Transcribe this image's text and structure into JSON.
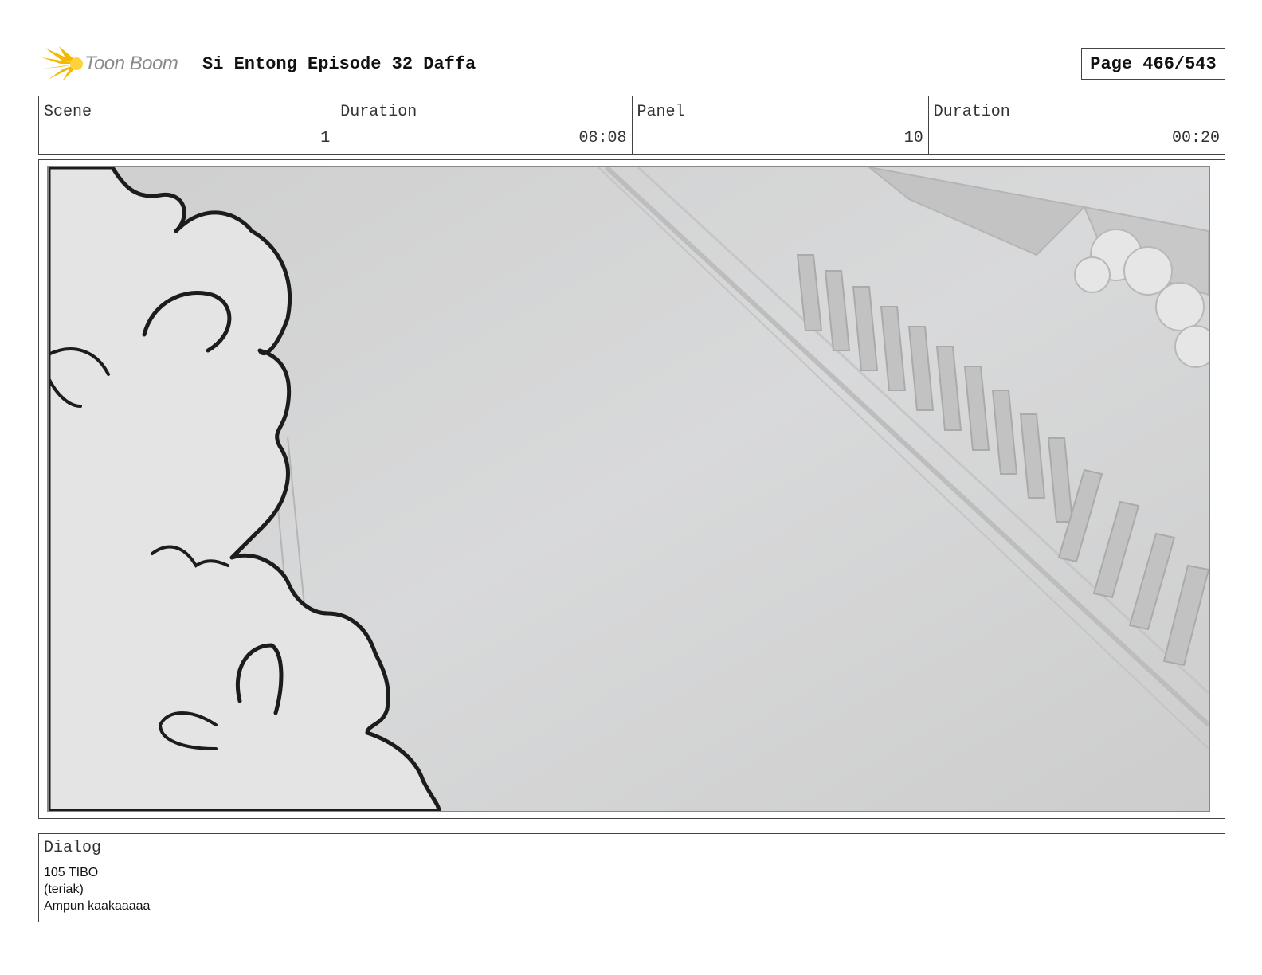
{
  "header": {
    "logo_text": "Toon Boom",
    "title": "Si Entong Episode 32 Daffa",
    "page": "Page 466/543"
  },
  "info": {
    "scene_label": "Scene",
    "scene_value": "1",
    "scene_duration_label": "Duration",
    "scene_duration_value": "08:08",
    "panel_label": "Panel",
    "panel_value": "10",
    "panel_duration_label": "Duration",
    "panel_duration_value": "00:20"
  },
  "dialog": {
    "label": "Dialog",
    "lines": [
      "105 TIBO",
      "(teriak)",
      "Ampun kaakaaaaa"
    ]
  },
  "colors": {
    "logo_accent": "#f5b800",
    "logo_text": "#8a8a8a",
    "border": "#444444",
    "panel_bg": "#d6d6d6"
  }
}
